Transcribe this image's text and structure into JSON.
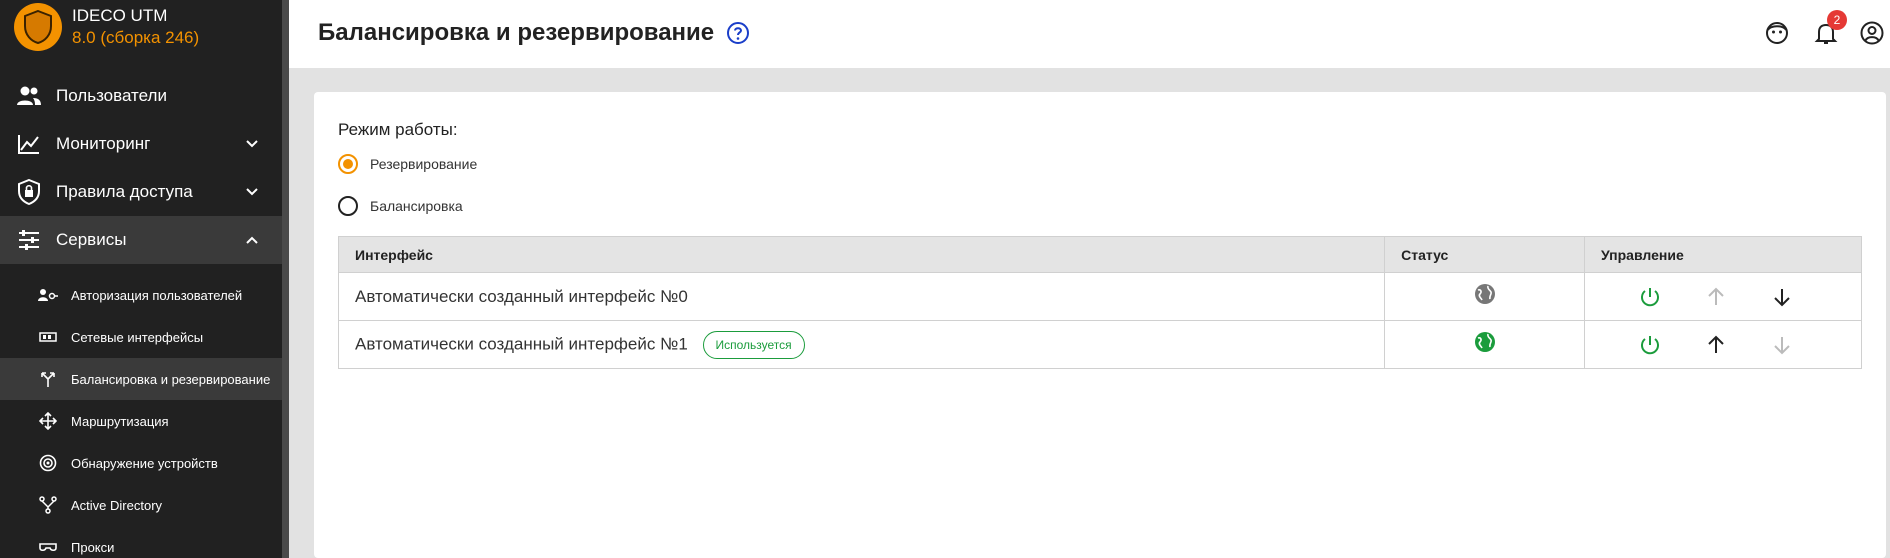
{
  "app": {
    "name": "IDECO UTM",
    "version": "8.0 (сборка 246)"
  },
  "sidebar": {
    "items": [
      {
        "label": "Пользователи",
        "icon": "users-icon"
      },
      {
        "label": "Мониторинг",
        "icon": "chart-line-icon"
      },
      {
        "label": "Правила доступа",
        "icon": "shield-lock-icon"
      },
      {
        "label": "Сервисы",
        "icon": "sliders-icon"
      }
    ],
    "subitems": [
      {
        "label": "Авторизация пользователей",
        "icon": "user-key-icon"
      },
      {
        "label": "Сетевые интерфейсы",
        "icon": "network-card-icon"
      },
      {
        "label": "Балансировка и резервирование",
        "icon": "arrows-split-icon"
      },
      {
        "label": "Маршрутизация",
        "icon": "arrows-cross-icon"
      },
      {
        "label": "Обнаружение устройств",
        "icon": "radar-icon"
      },
      {
        "label": "Active Directory",
        "icon": "directory-tree-icon"
      },
      {
        "label": "Прокси",
        "icon": "mask-icon"
      }
    ]
  },
  "header": {
    "title": "Балансировка и резервирование",
    "notifications_count": "2"
  },
  "main": {
    "mode_label": "Режим работы:",
    "modes": [
      {
        "label": "Резервирование",
        "selected": true
      },
      {
        "label": "Балансировка",
        "selected": false
      }
    ],
    "table": {
      "columns": [
        "Интерфейс",
        "Статус",
        "Управление"
      ],
      "rows": [
        {
          "name": "Автоматически созданный интерфейс №0",
          "badge": "",
          "status": "inactive",
          "up_enabled": false,
          "down_enabled": true
        },
        {
          "name": "Автоматически созданный интерфейс №1",
          "badge": "Используется",
          "status": "active",
          "up_enabled": true,
          "down_enabled": false
        }
      ]
    }
  },
  "colors": {
    "accent": "#f39200",
    "sidebar_bg": "#212121",
    "success": "#1b9c3c"
  }
}
